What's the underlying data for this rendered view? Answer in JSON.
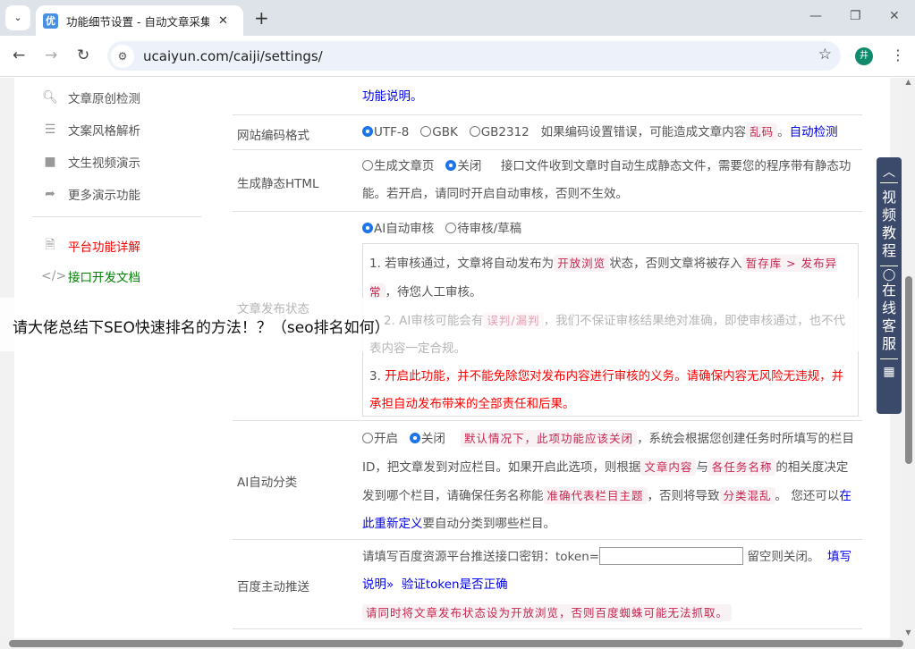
{
  "browser": {
    "tab_title": "功能细节设置 - 自动文章采集器",
    "favicon": "优",
    "url": "ucaiyun.com/caiji/settings/",
    "profile": "井"
  },
  "sidebar": {
    "items": [
      {
        "icon": "search-icon",
        "label": "文章原创检测"
      },
      {
        "icon": "list-icon",
        "label": "文案风格解析"
      },
      {
        "icon": "video-icon",
        "label": "文生视频演示"
      },
      {
        "icon": "share-icon",
        "label": "更多演示功能"
      },
      {
        "icon": "document-icon",
        "label": "平台功能详解",
        "color": "#ff0000"
      },
      {
        "icon": "code-icon",
        "label": "接口开发文档",
        "color": "#008000"
      }
    ]
  },
  "top_row": {
    "link": "功能说明。"
  },
  "encoding": {
    "label": "网站编码格式",
    "options": [
      "UTF-8",
      "GBK",
      "GB2312"
    ],
    "selected": "UTF-8",
    "note": "如果编码设置错误，可能造成文章内容",
    "code": "乱码",
    "period": "。",
    "link": "自动检测"
  },
  "static_html": {
    "label": "生成静态HTML",
    "options": [
      "生成文章页",
      "关闭"
    ],
    "selected": "关闭",
    "note": "接口文件收到文章时自动生成静态文件，需要您的程序带有静态功能。若开启，请同时开启自动审核，否则不生效。"
  },
  "publish_status": {
    "label": "文章发布状态",
    "options": [
      "AI自动审核",
      "待审核/草稿"
    ],
    "selected": "AI自动审核",
    "p1a": "1. 若审核通过，文章将自动发布为",
    "p1code1": "开放浏览",
    "p1b": "状态，否则文章将被存入",
    "p1code2": "暂存库 > 发布异常",
    "p1c": "，待您人工审核。",
    "p2a": "2. AI审核可能会有",
    "p2code": "误判/漏判",
    "p2b": "，我们不保证审核结果绝对准确，即使审核通过，也不代表内容一定合规。",
    "p3num": "3. ",
    "p3": "开启此功能，并不能免除您对发布内容进行审核的义务。请确保内容无风险无违规，并承担自动发布带来的全部责任和后果。"
  },
  "ai_classify": {
    "label": "AI自动分类",
    "options": [
      "开启",
      "关闭"
    ],
    "selected": "关闭",
    "code1": "默认情况下，此项功能应该关闭",
    "t1": "，系统会根据您创建任务时所填写的栏目ID，把文章发到对应栏目。如果开启此选项，则根据",
    "code2": "文章内容",
    "t2": "与",
    "code3": "各任务名称",
    "t3": "的相关度决定发到哪个栏目，请确保任务名称能",
    "code4": "准确代表栏目主题",
    "t4": "，否则将导致",
    "code5": "分类混乱",
    "t5": "。 您还可以",
    "link": "在此重新定义",
    "t6": "要自动分类到哪些栏目。"
  },
  "baidu_push": {
    "label": "百度主动推送",
    "prompt": "请填写百度资源平台推送接口密钥：token=",
    "token_value": "",
    "after": "留空则关闭。",
    "link1": "填写说明",
    "link2": "验证token是否正确",
    "code": "请同时将文章发布状态设为开放浏览，否则百度蜘蛛可能无法抓取。"
  },
  "float_panel": {
    "video": "视频教程",
    "service": "在线客服"
  },
  "overlay_title": "请大佬总结下SEO快速排名的方法！？（seo排名如何）"
}
